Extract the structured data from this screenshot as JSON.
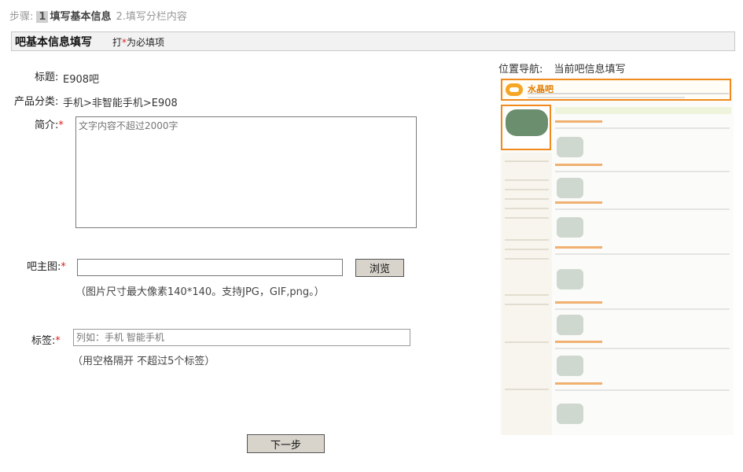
{
  "steps": {
    "prefix": "步骤:",
    "step1_num": "1",
    "step1_label": "填写基本信息",
    "step2_label": "2.填写分栏内容"
  },
  "section": {
    "title": "吧基本信息填写",
    "note_prefix": "打",
    "note_star": "*",
    "note_suffix": "为必填项"
  },
  "form": {
    "title_label": "标题:",
    "title_value": "E908吧",
    "category_label": "产品分类:",
    "category_value": "手机>非智能手机>E908",
    "intro_label": "简介:",
    "intro_placeholder": "文字内容不超过2000字",
    "image_label": "吧主图:",
    "browse_label": "浏览",
    "image_hint": "（图片尺寸最大像素140*140。支持JPG，GIF,png。）",
    "tags_label": "标签:",
    "tags_placeholder": "列如：手机 智能手机",
    "tags_hint": "（用空格隔开 不超过5个标签）",
    "required_mark": "*",
    "next_label": "下一步"
  },
  "preview": {
    "nav_label": "位置导航:",
    "nav_value": "当前吧信息填写",
    "forum_name": "水晶吧"
  },
  "colors": {
    "accent_orange": "#f08a1c",
    "required_red": "#e02020",
    "header_bg": "#f2f2f2"
  }
}
